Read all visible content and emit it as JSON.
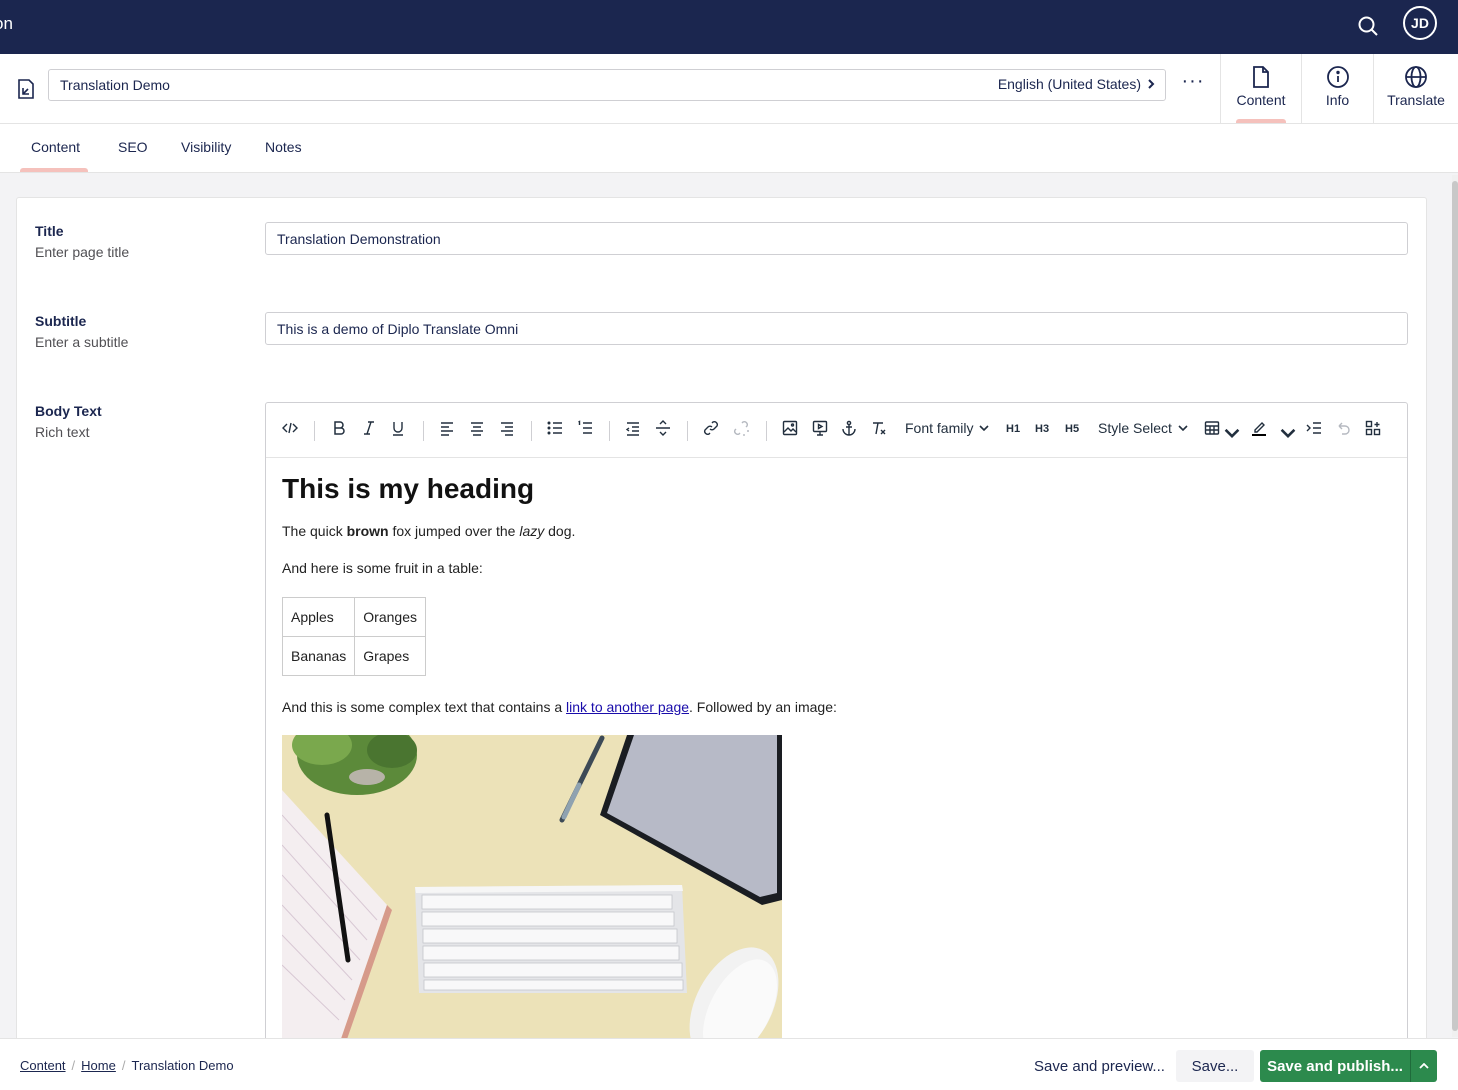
{
  "topbar": {
    "brand_fragment": "on",
    "avatar_initials": "JD"
  },
  "header": {
    "name_value": "Translation Demo",
    "culture": "English (United States)",
    "more_label": "···",
    "apps": [
      {
        "label": "Content",
        "icon": "document-icon"
      },
      {
        "label": "Info",
        "icon": "info-icon"
      },
      {
        "label": "Translate",
        "icon": "globe-icon"
      }
    ]
  },
  "subtabs": [
    "Content",
    "SEO",
    "Visibility",
    "Notes"
  ],
  "fields": {
    "title": {
      "label": "Title",
      "description": "Enter page title",
      "value": "Translation Demonstration"
    },
    "subtitle": {
      "label": "Subtitle",
      "description": "Enter a subtitle",
      "value": "This is a demo of Diplo Translate Omni"
    },
    "body": {
      "label": "Body Text",
      "description": "Rich text"
    }
  },
  "toolbar": {
    "font_family": "Font family",
    "style_select": "Style Select",
    "h1": "H1",
    "h3": "H3",
    "h5": "H5"
  },
  "rte": {
    "heading": "This is my heading",
    "p1_pre": "The quick ",
    "p1_bold": "brown",
    "p1_mid": " fox jumped over the ",
    "p1_italic": "lazy",
    "p1_post": " dog.",
    "p2": "And here is some fruit in a table:",
    "table": [
      [
        "Apples",
        "Oranges"
      ],
      [
        "Bananas",
        "Grapes"
      ]
    ],
    "p3_pre": "And this is some complex text that contains a ",
    "p3_link": "link to another page",
    "p3_post": ". Followed by an image:"
  },
  "footer": {
    "breadcrumbs": [
      "Content",
      "Home",
      "Translation Demo"
    ],
    "save_preview": "Save and preview...",
    "save": "Save...",
    "save_publish": "Save and publish..."
  },
  "colors": {
    "topbar": "#1b264f",
    "publish": "#2c8a4d",
    "tab_indicator": "#f5c1bc"
  }
}
